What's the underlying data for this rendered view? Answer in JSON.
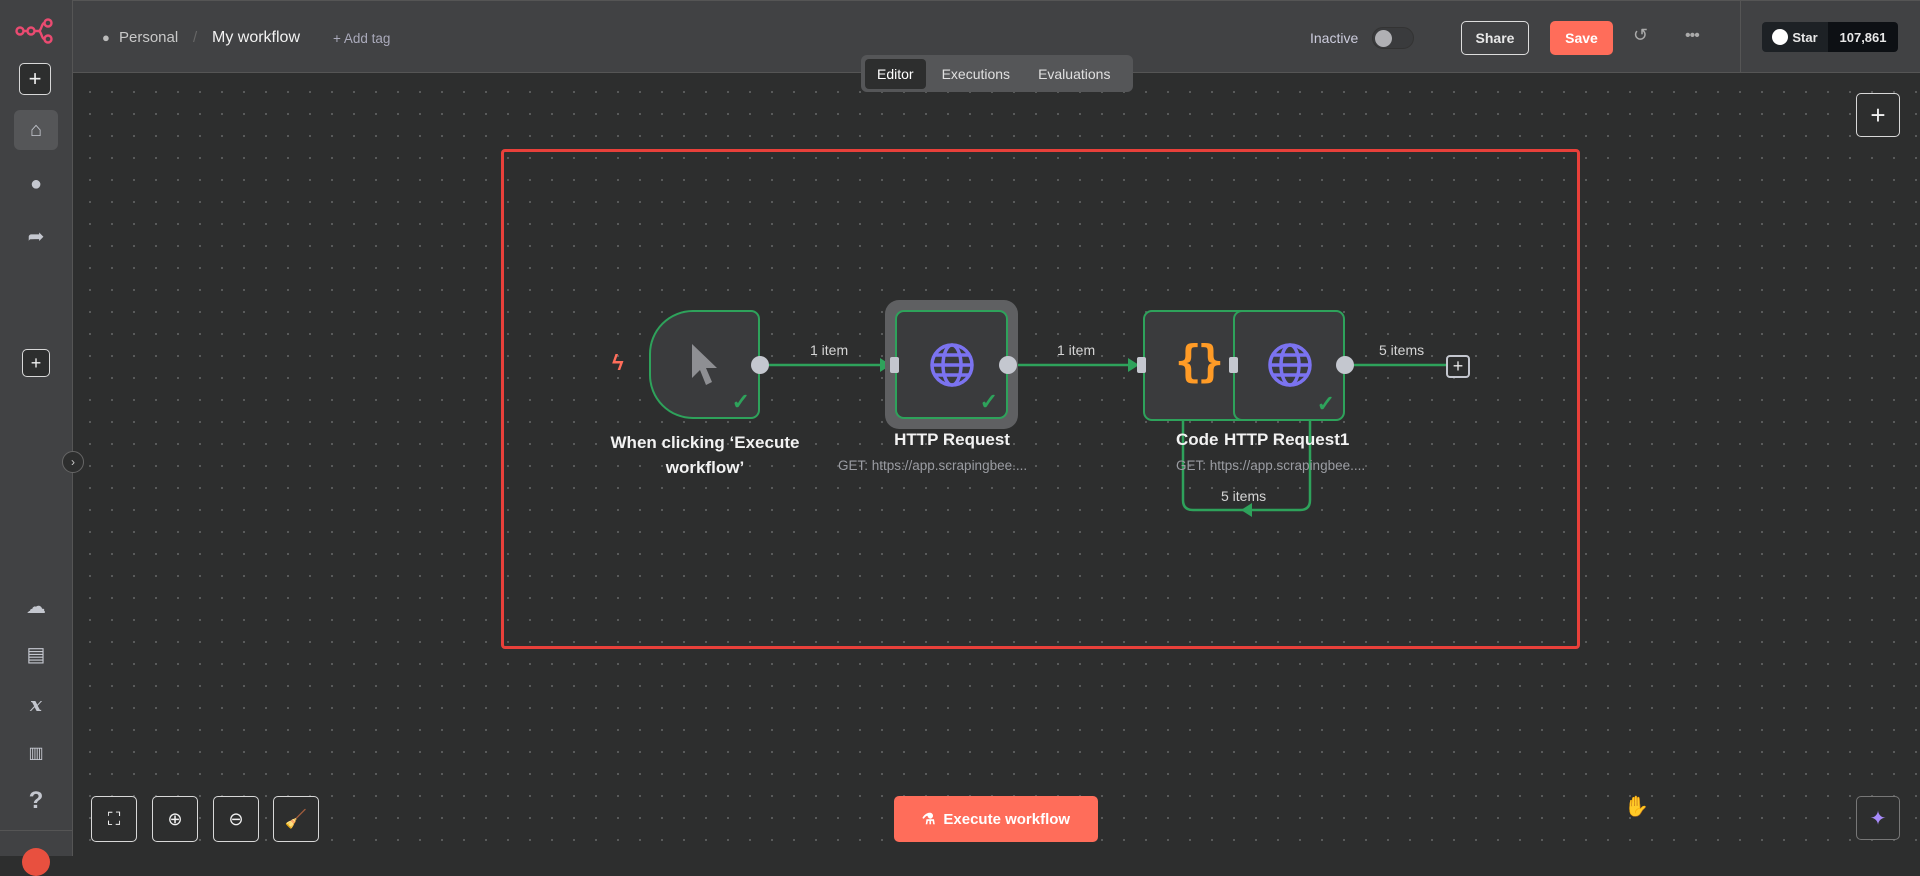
{
  "header": {
    "project": "Personal",
    "workflow_name": "My workflow",
    "add_tag": "+ Add tag",
    "status_label": "Inactive",
    "active": false,
    "share": "Share",
    "save": "Save",
    "github_star": "Star",
    "github_count": "107,861"
  },
  "tabs": [
    {
      "label": "Editor",
      "active": true
    },
    {
      "label": "Executions"
    },
    {
      "label": "Evaluations"
    }
  ],
  "nodes": [
    {
      "name": "When clicking ‘Execute",
      "name2": "workflow’",
      "icon": "cursor-icon",
      "status": "success"
    },
    {
      "name": "HTTP Request",
      "subtitle": "GET: https://app.scrapingbee....",
      "icon": "globe-icon",
      "status": "success"
    },
    {
      "name": "Code",
      "icon": "code-braces-icon",
      "status": "success"
    },
    {
      "name": "HTTP Request1",
      "subtitle": "GET: https://app.scrapingbee....",
      "icon": "globe-icon",
      "status": "success"
    }
  ],
  "edges": [
    {
      "label": "1 item"
    },
    {
      "label": "1 item"
    },
    {
      "label": "5 items"
    },
    {
      "label": "5 items"
    }
  ],
  "footer": {
    "execute": "Execute workflow"
  },
  "colors": {
    "accent": "#ff6d5a",
    "success": "#2ea25b",
    "globe": "#7b73f0",
    "code": "#ff9b26",
    "selection": "#e8403a"
  }
}
